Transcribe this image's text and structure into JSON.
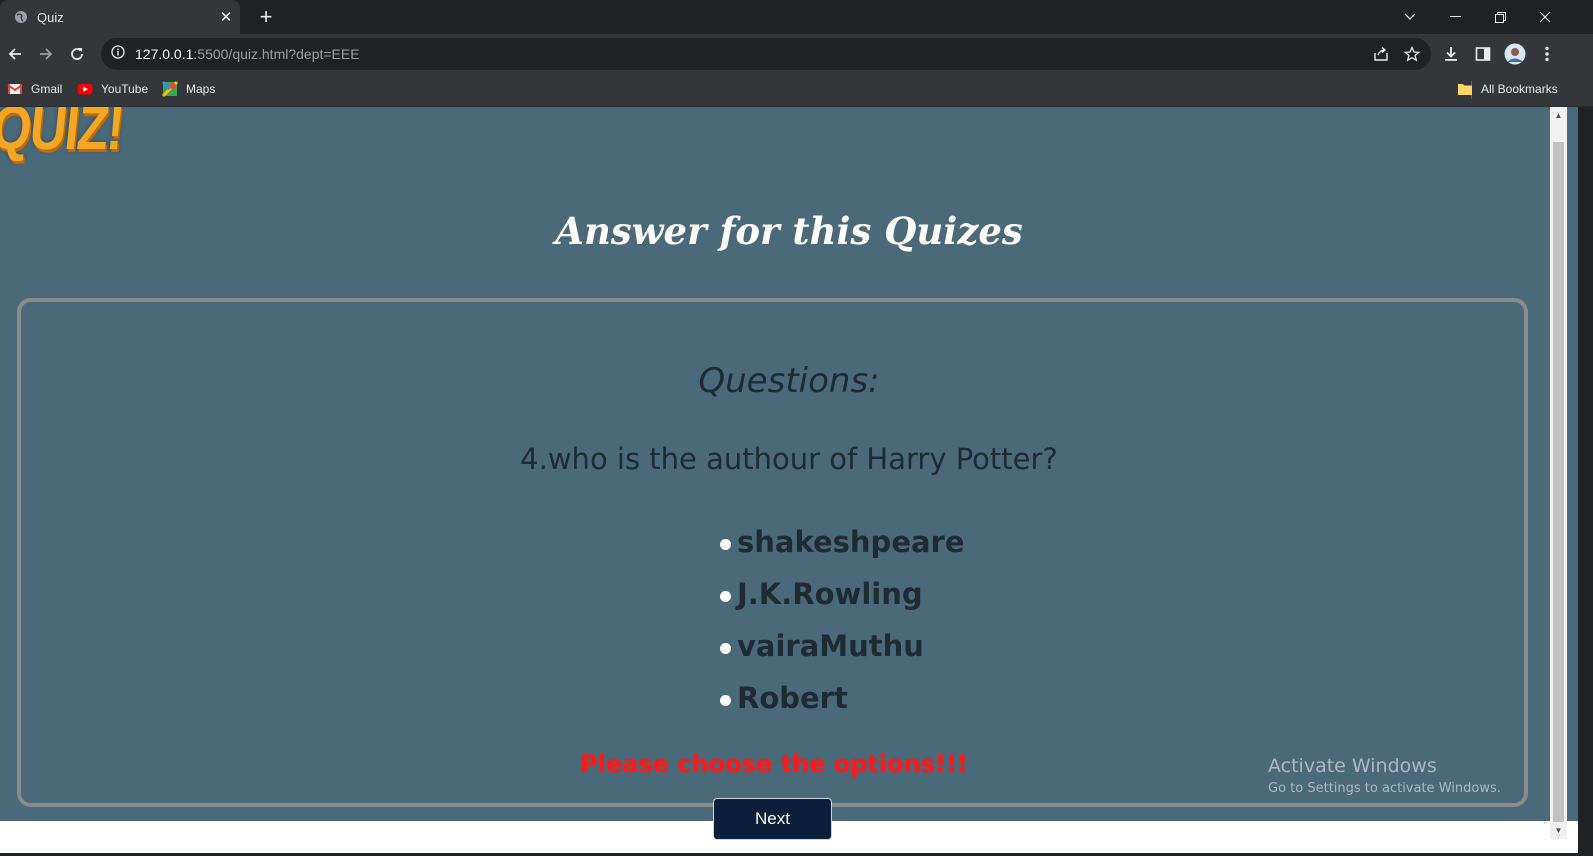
{
  "browser": {
    "tab_title": "Quiz",
    "url_host": "127.0.0.1",
    "url_rest": ":5500/quiz.html?dept=EEE",
    "bookmarks": [
      {
        "label": "Gmail",
        "icon": "gmail-icon"
      },
      {
        "label": "YouTube",
        "icon": "youtube-icon"
      },
      {
        "label": "Maps",
        "icon": "maps-icon"
      }
    ],
    "all_bookmarks": "All Bookmarks"
  },
  "page": {
    "logo_text": "QUIZ!",
    "heading": "Answer for this Quizes",
    "questions_label": "Questions:",
    "question": "4.who is the authour of Harry Potter?",
    "options": [
      "shakeshpeare",
      "J.K.Rowling",
      "vairaMuthu",
      "Robert"
    ],
    "warning": "Please choose the options!!!",
    "next_label": "Next"
  },
  "overlay": {
    "activate_title": "Activate Windows",
    "activate_sub": "Go to Settings to activate Windows."
  },
  "colors": {
    "page_bg": "#4a6a79",
    "warning": "#ff1a1a",
    "next_bg": "#0b1f3a",
    "logo": "#f5a623"
  }
}
